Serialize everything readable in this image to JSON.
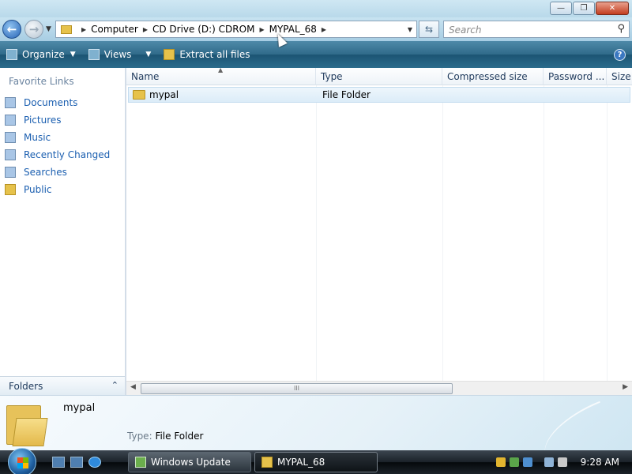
{
  "window": {
    "controls": {
      "minimize": "—",
      "maximize": "❐",
      "close": "✕"
    }
  },
  "address": {
    "back_icon": "back-arrow-icon",
    "forward_icon": "forward-arrow-icon",
    "breadcrumbs": [
      "Computer",
      "CD Drive (D:) CDROM",
      "MYPAL_68"
    ],
    "search_placeholder": "Search"
  },
  "toolbar": {
    "organize": "Organize",
    "views": "Views",
    "extract": "Extract all files",
    "help": "?"
  },
  "nav": {
    "favorites_title": "Favorite Links",
    "items": [
      {
        "label": "Documents",
        "icon": "documents-icon"
      },
      {
        "label": "Pictures",
        "icon": "pictures-icon"
      },
      {
        "label": "Music",
        "icon": "music-icon"
      },
      {
        "label": "Recently Changed",
        "icon": "recent-icon"
      },
      {
        "label": "Searches",
        "icon": "searches-icon"
      },
      {
        "label": "Public",
        "icon": "public-folder-icon"
      }
    ],
    "folders_label": "Folders"
  },
  "list": {
    "columns": [
      "Name",
      "Type",
      "Compressed size",
      "Password ...",
      "Size"
    ],
    "rows": [
      {
        "name": "mypal",
        "type": "File Folder"
      }
    ],
    "scroll_grip": "III"
  },
  "details": {
    "name": "mypal",
    "type_label": "Type:",
    "type_value": "File Folder"
  },
  "taskbar": {
    "buttons": [
      "Windows Update",
      "MYPAL_68"
    ],
    "clock": "9:28 AM"
  },
  "colors": {
    "toolbar": "#2f6a89",
    "link": "#1b5fb0",
    "selection": "#dcecf8",
    "taskbar": "#1a2128"
  }
}
